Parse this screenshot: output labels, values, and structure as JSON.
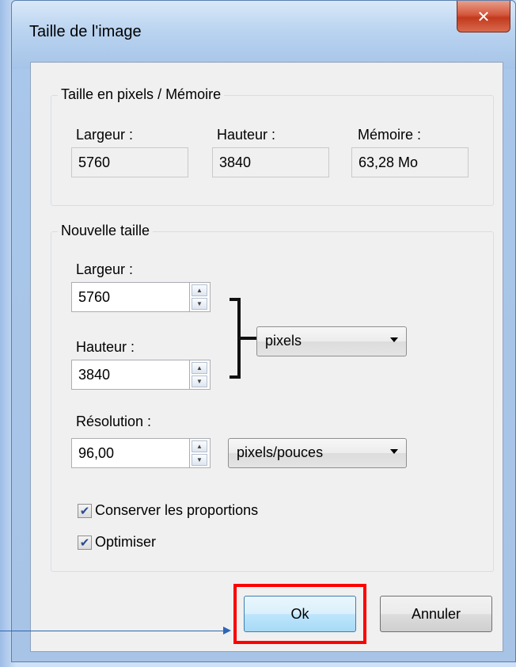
{
  "window": {
    "title": "Taille de l'image",
    "close_icon": "close-icon"
  },
  "pixel_memory": {
    "title": "Taille en pixels / Mémoire",
    "width_label": "Largeur :",
    "width_value": "5760",
    "height_label": "Hauteur :",
    "height_value": "3840",
    "memory_label": "Mémoire :",
    "memory_value": "63,28 Mo"
  },
  "new_size": {
    "title": "Nouvelle taille",
    "width_label": "Largeur :",
    "width_value": "5760",
    "height_label": "Hauteur :",
    "height_value": "3840",
    "unit_selected": "pixels",
    "resolution_label": "Résolution :",
    "resolution_value": "96,00",
    "resolution_unit_selected": "pixels/pouces",
    "keep_proportions_label": "Conserver les proportions",
    "keep_proportions_checked": true,
    "optimize_label": "Optimiser",
    "optimize_checked": true
  },
  "buttons": {
    "ok_label": "Ok",
    "cancel_label": "Annuler"
  },
  "colors": {
    "highlight": "#ff0000",
    "arrow": "#2f66b3"
  }
}
